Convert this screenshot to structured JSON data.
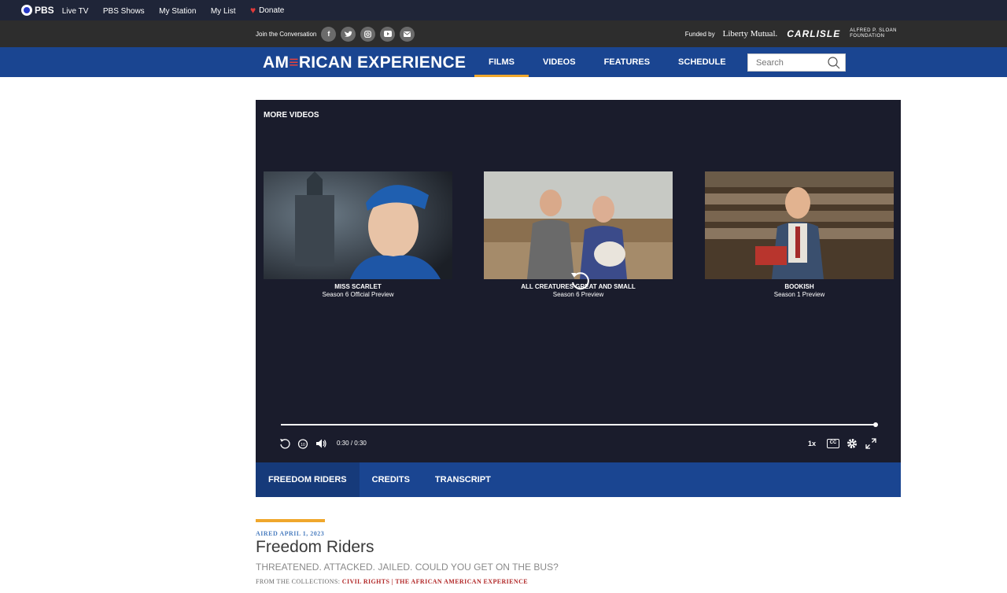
{
  "pbs_bar": {
    "logo_text": "PBS",
    "links": [
      "Live TV",
      "PBS Shows",
      "My Station",
      "My List"
    ],
    "donate": "Donate"
  },
  "sub_bar": {
    "join_text": "Join the Conversation",
    "social_icons": [
      "facebook-icon",
      "twitter-icon",
      "instagram-icon",
      "youtube-icon",
      "email-icon"
    ],
    "funded_text": "Funded by",
    "sponsors": [
      "Liberty Mutual.",
      "CARLISLE",
      "ALFRED P. SLOAN",
      "FOUNDATION"
    ]
  },
  "nav": {
    "brand_a": "AM",
    "brand_e": "≡",
    "brand_rest": "RICAN EXPERIENCE",
    "tabs": [
      "FILMS",
      "VIDEOS",
      "FEATURES",
      "SCHEDULE"
    ],
    "active_tab": "FILMS",
    "search_placeholder": "Search"
  },
  "player": {
    "section_title": "MORE VIDEOS",
    "cards": [
      {
        "title": "MISS SCARLET",
        "subtitle": "Season 6 Official Preview"
      },
      {
        "title": "ALL CREATURES GREAT AND SMALL",
        "subtitle": "Season 6 Preview"
      },
      {
        "title": "BOOKISH",
        "subtitle": "Season 1 Preview"
      }
    ],
    "time_current": "0:30",
    "time_separator": "/",
    "time_total": "0:30",
    "progress": 1.0,
    "playback_rate": "1x",
    "cc_label": "CC"
  },
  "episode_tabs": [
    "FREEDOM RIDERS",
    "CREDITS",
    "TRANSCRIPT"
  ],
  "episode": {
    "aired": "AIRED APRIL 1, 2023",
    "title": "Freedom Riders",
    "tagline": "THREATENED. ATTACKED. JAILED. COULD YOU GET ON THE BUS?",
    "collections_prefix": "FROM THE COLLECTIONS:",
    "collection_1": "CIVIL RIGHTS",
    "collection_sep": "|",
    "collection_2": "THE AFRICAN AMERICAN EXPERIENCE"
  },
  "colors": {
    "pbs_bar": "#1f2538",
    "nav_blue": "#1a4591",
    "accent_gold": "#f0a72c",
    "link_red": "#b22a2a",
    "player_bg": "#1a1c2c"
  }
}
